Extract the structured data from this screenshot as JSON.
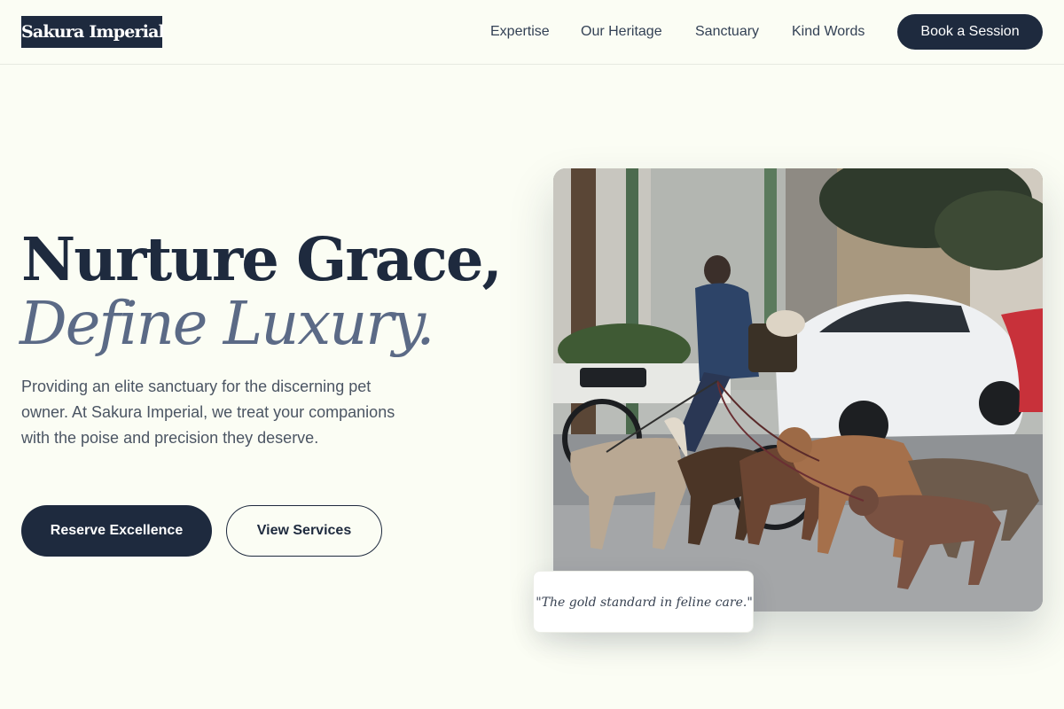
{
  "brand": {
    "name": "Sakura Imperial"
  },
  "nav": {
    "links": [
      "Expertise",
      "Our Heritage",
      "Sanctuary",
      "Kind Words"
    ],
    "cta_label": "Book a Session"
  },
  "hero": {
    "headline_line1": "Nurture Grace,",
    "headline_line2": "Define Luxury.",
    "lead": "Providing an elite sanctuary for the discerning pet owner. At Sakura Imperial, we treat your companions with the poise and precision they deserve.",
    "primary_button": "Reserve Excellence",
    "secondary_button": "View Services",
    "quote": "\"The gold standard in feline care.\""
  },
  "colors": {
    "background": "#fbfdf4",
    "navy": "#1e2a3e",
    "slate_accent": "#5b6a86",
    "body_text": "#4b5563"
  },
  "icons": []
}
